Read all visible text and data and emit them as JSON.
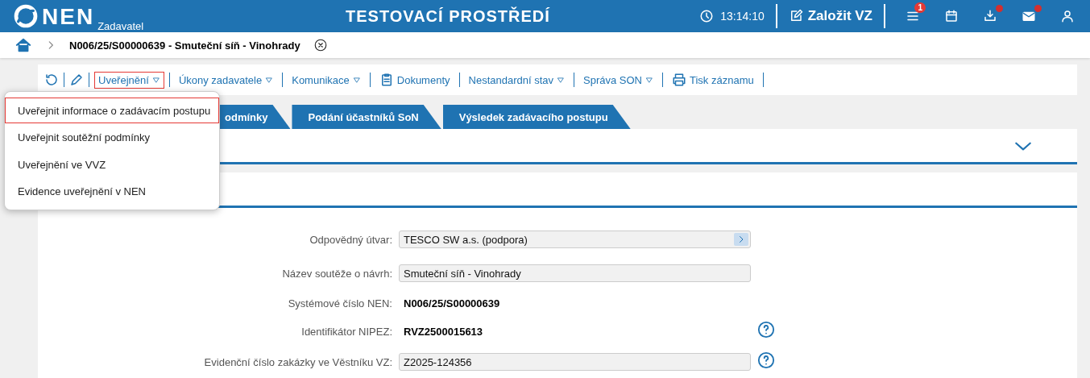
{
  "header": {
    "logo": "NEN",
    "logo_sub": "Zadavatel",
    "title": "TESTOVACÍ PROSTŘEDÍ",
    "time": "13:14:10",
    "create_button": "Založit VZ",
    "icons": [
      {
        "kind": "menu",
        "badge": "1",
        "dot": false
      },
      {
        "kind": "calendar",
        "dot": false
      },
      {
        "kind": "download",
        "dot": true
      },
      {
        "kind": "mail",
        "dot": true
      },
      {
        "kind": "user",
        "dot": false
      }
    ]
  },
  "breadcrumb": {
    "title": "N006/25/S00000639 - Smuteční síň - Vinohrady"
  },
  "toolbar": [
    {
      "kind": "refresh"
    },
    {
      "kind": "edit"
    },
    {
      "kind": "menu",
      "label": "Uveřejnění",
      "selected": true
    },
    {
      "kind": "menu",
      "label": "Úkony zadavatele",
      "selected": false
    },
    {
      "kind": "menu",
      "label": "Komunikace",
      "selected": false
    },
    {
      "kind": "doc",
      "label": "Dokumenty"
    },
    {
      "kind": "menu",
      "label": "Nestandardní stav",
      "selected": false
    },
    {
      "kind": "menu",
      "label": "Správa SON",
      "selected": false
    },
    {
      "kind": "print",
      "label": "Tisk záznamu"
    }
  ],
  "dropdown": [
    {
      "label": "Uveřejnit informace o zadávacím postupu",
      "selected": true
    },
    {
      "label": "Uveřejnit soutěžní podmínky",
      "selected": false
    },
    {
      "label": "Uveřejnění ve VVZ",
      "selected": false
    },
    {
      "label": "Evidence uveřejnění v NEN",
      "selected": false
    }
  ],
  "tabs": [
    {
      "label": "odmínky"
    },
    {
      "label": "Podání účastníků SoN"
    },
    {
      "label": "Výsledek zadávacího postupu"
    }
  ],
  "form": [
    {
      "kind": "select",
      "label": "Odpovědný útvar:",
      "value": "TESCO SW a.s. (podpora)",
      "help": false
    },
    {
      "kind": "input",
      "label": "Název soutěže o návrh:",
      "value": "Smuteční síň - Vinohrady",
      "help": false
    },
    {
      "kind": "text",
      "label": "Systémové číslo NEN:",
      "value": "N006/25/S00000639",
      "help": false
    },
    {
      "kind": "text",
      "label": "Identifikátor NIPEZ:",
      "value": "RVZ2500015613",
      "help": true
    },
    {
      "kind": "input",
      "label": "Evidenční číslo zakázky ve Věstníku VZ:",
      "value": "Z2025-124356",
      "help": true
    }
  ]
}
